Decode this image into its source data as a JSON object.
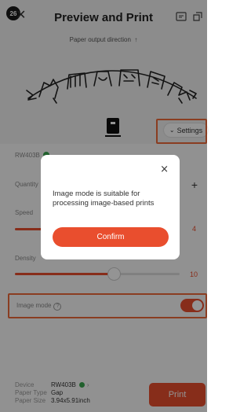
{
  "header": {
    "step_badge": "26",
    "back_icon": "✕",
    "title": "Preview and Print"
  },
  "preview": {
    "direction_text": "Paper output direction",
    "direction_arrow": "↑",
    "settings_label": "Settings"
  },
  "settings": {
    "printer_name": "RW403B",
    "quantity_label": "Quantity",
    "quantity_plus": "+",
    "speed_label": "Speed",
    "speed_value": "4",
    "density_label": "Density",
    "density_value": "10",
    "image_mode_label": "Image mode",
    "image_mode_help": "?",
    "image_mode_on": true
  },
  "footer": {
    "device_key": "Device",
    "device_value": "RW403B",
    "paper_type_key": "Paper Type",
    "paper_type_value": "Gap",
    "paper_size_key": "Paper Size",
    "paper_size_value": "3.94x5.91inch",
    "print_label": "Print"
  },
  "dialog": {
    "close_icon": "×",
    "message": "Image mode is suitable for processing image-based prints",
    "confirm_label": "Confirm"
  },
  "colors": {
    "accent": "#e94e2e",
    "highlight": "#ee6a3a",
    "ok": "#3aa54f",
    "overlay": "rgba(0,0,0,0.42)"
  }
}
